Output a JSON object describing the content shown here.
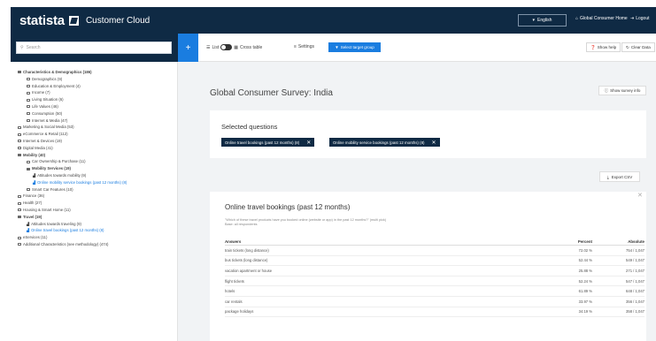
{
  "header": {
    "logo": "statista",
    "product": "Customer Cloud",
    "language_label": "English",
    "home_link": "Global Consumer Home",
    "logout_link": "Logout"
  },
  "sidebar": {
    "search_placeholder": "Search",
    "tree": [
      {
        "label": "Characteristics & Demographics (186)",
        "level": 0,
        "bold": true,
        "open": true
      },
      {
        "label": "Demographics (9)",
        "level": 1
      },
      {
        "label": "Education & Employment (4)",
        "level": 1
      },
      {
        "label": "Income (7)",
        "level": 1
      },
      {
        "label": "Living Situation (6)",
        "level": 1
      },
      {
        "label": "Life Values (46)",
        "level": 1
      },
      {
        "label": "Consumption (50)",
        "level": 1
      },
      {
        "label": "Internet & Media (47)",
        "level": 1
      },
      {
        "label": "Marketing & Social Media (53)",
        "level": 0
      },
      {
        "label": "eCommerce & Retail (112)",
        "level": 0
      },
      {
        "label": "Internet & Devices (19)",
        "level": 0
      },
      {
        "label": "Digital Media (41)",
        "level": 0
      },
      {
        "label": "Mobility (40)",
        "level": 0,
        "bold": true,
        "open": true
      },
      {
        "label": "Car Ownership & Purchase (11)",
        "level": 1
      },
      {
        "label": "Mobility Services (19)",
        "level": 1,
        "bold": true,
        "open": true
      },
      {
        "label": "Attitudes towards mobility (9)",
        "level": 2,
        "chart": true
      },
      {
        "label": "Online mobility service bookings (past 12 months) (8)",
        "level": 2,
        "chart": true,
        "active": true
      },
      {
        "label": "Smart Car Features (10)",
        "level": 1
      },
      {
        "label": "Finance (36)",
        "level": 0
      },
      {
        "label": "Health (27)",
        "level": 0
      },
      {
        "label": "Housing & Smart Home (11)",
        "level": 0
      },
      {
        "label": "Travel (19)",
        "level": 0,
        "bold": true,
        "open": true
      },
      {
        "label": "Attitudes towards traveling (9)",
        "level": 1,
        "chart": true
      },
      {
        "label": "Online travel bookings (past 12 months) (8)",
        "level": 1,
        "chart": true,
        "active": true
      },
      {
        "label": "eServices (11)",
        "level": 0
      },
      {
        "label": "Additional Characteristics (see methodology) (474)",
        "level": 0
      }
    ]
  },
  "toolbar": {
    "list_label": "List",
    "cross_table_label": "Cross table",
    "settings_label": "Settings",
    "target_group_label": "Select target group",
    "show_help_label": "Show help",
    "clear_data_label": "Clear Data"
  },
  "main": {
    "survey_title": "Global Consumer Survey: India",
    "survey_info_label": "Show survey info",
    "selected_title": "Selected questions",
    "chips": [
      "Online travel bookings (past 12 months) (8)",
      "Online mobility service bookings (past 12 months) (8)"
    ],
    "export_label": "Export CSV",
    "question": {
      "title": "Online travel bookings (past 12 months)",
      "text": "\"Which of these travel products have you booked online (website or app) in the past 12 months?\" (multi pick)",
      "base": "Base: all respondents",
      "columns": [
        "Answers",
        "Percent",
        "Absolute"
      ],
      "rows": [
        [
          "train tickets (long distance)",
          "72.02 %",
          "754 / 1,047"
        ],
        [
          "bus tickets (long distance)",
          "52.44 %",
          "549 / 1,047"
        ],
        [
          "vacation apartment or house",
          "25.88 %",
          "271 / 1,047"
        ],
        [
          "flight tickets",
          "52.24 %",
          "547 / 1,047"
        ],
        [
          "hotels",
          "61.89 %",
          "648 / 1,047"
        ],
        [
          "car rentals",
          "33.97 %",
          "356 / 1,047"
        ],
        [
          "package holidays",
          "34.19 %",
          "358 / 1,047"
        ]
      ]
    }
  }
}
